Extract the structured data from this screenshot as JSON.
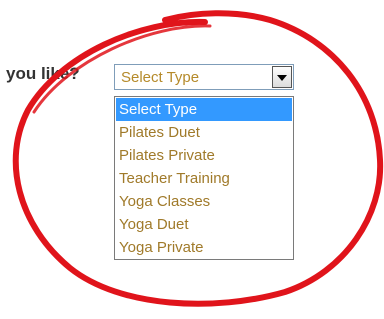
{
  "question_text": "you like?",
  "select": {
    "current_value": "Select Type",
    "options": [
      {
        "label": "Select Type",
        "selected": true
      },
      {
        "label": "Pilates Duet",
        "selected": false
      },
      {
        "label": "Pilates Private",
        "selected": false
      },
      {
        "label": "Teacher Training",
        "selected": false
      },
      {
        "label": "Yoga Classes",
        "selected": false
      },
      {
        "label": "Yoga Duet",
        "selected": false
      },
      {
        "label": "Yoga Private",
        "selected": false
      }
    ]
  },
  "colors": {
    "annotation_circle": "#e0141b",
    "highlight": "#3399ff",
    "option_text": "#a07a2a"
  },
  "icons": {
    "dropdown_arrow": "chevron-down-icon"
  }
}
